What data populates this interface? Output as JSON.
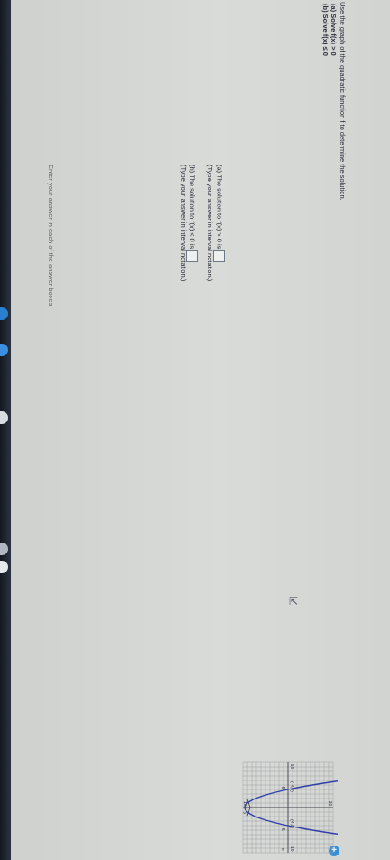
{
  "question": {
    "instruction": "Use the graph of the quadratic function f to determine the solution.",
    "part_a": "(a) Solve f(x) > 0",
    "part_b": "(b) Solve f(x) ≤ 0"
  },
  "answers": {
    "a_prompt": "(a) The solution to f(x) > 0 is",
    "a_hint": "(Type your answer in interval notation.)",
    "b_prompt": "(b) The solution to f(x) ≤ 0 is",
    "b_hint": "(Type your answer in interval notation.)",
    "a_value": "",
    "b_value": ""
  },
  "footer": {
    "instruction": "Enter your answer in each of the answer boxes."
  },
  "graph": {
    "y_top_label": "10",
    "y_bottom_label": "-10",
    "x_left_label": "-10",
    "x_right_label": "10",
    "x_axis_name": "x",
    "y_axis_name": "y",
    "tick_neg": "-5",
    "tick_pos": "5",
    "point_label_left": "(-4,0)",
    "point_label_right": "(4,0)",
    "x_intercepts": [
      -4,
      4
    ],
    "colors": {
      "grid": "#9aa0a2",
      "axes": "#3d3f48",
      "curve": "#2f3fa8"
    }
  },
  "icons": {
    "add": "plus-circle-icon",
    "cursor": "mouse-pointer-icon"
  }
}
